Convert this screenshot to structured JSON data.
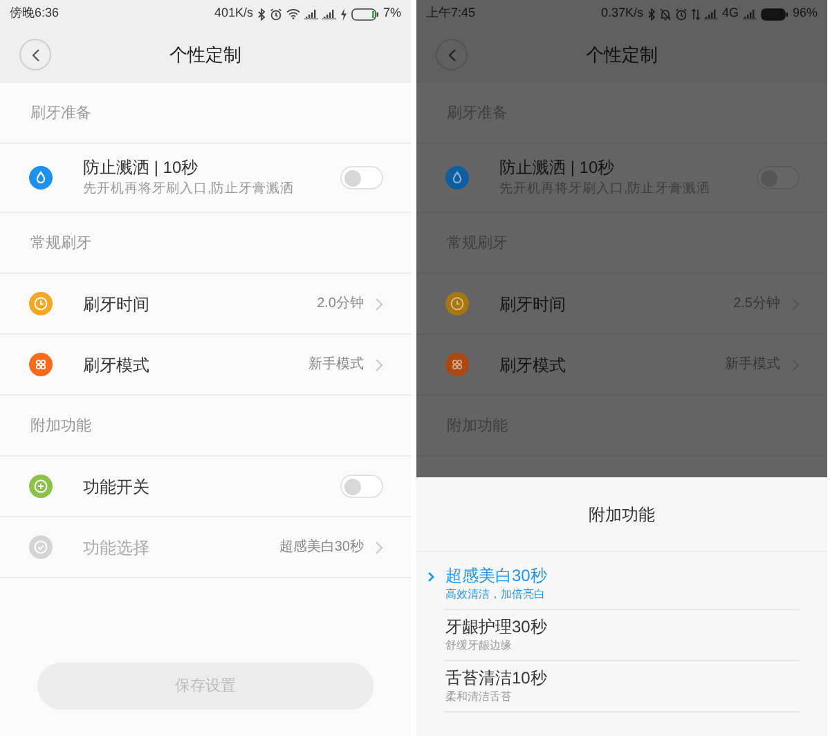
{
  "screens": [
    {
      "status_bar": {
        "time": "傍晚6:36",
        "speed": "401K/s",
        "indicators": [
          {
            "kind": "bluetooth"
          },
          {
            "kind": "alarm"
          },
          {
            "kind": "wifi"
          },
          {
            "kind": "signal"
          },
          {
            "kind": "signal"
          },
          {
            "kind": "charging"
          },
          {
            "kind": "battery_low"
          }
        ],
        "battery": "7%"
      },
      "header": {
        "title": "个性定制"
      },
      "sections": [
        {
          "title": "刷牙准备",
          "rows": [
            {
              "kind": "toggle",
              "color": "#1e90f0",
              "title": "防止溅洒 | 10秒",
              "subtitle": "先开机再将牙刷入口,防止牙膏溅洒",
              "on": false,
              "disabled": false
            }
          ]
        },
        {
          "title": "常规刷牙",
          "rows": [
            {
              "kind": "value",
              "color": "#f5a623",
              "title": "刷牙时间",
              "value": "2.0分钟",
              "disabled": false
            },
            {
              "kind": "value",
              "color": "#fa6a1e",
              "title": "刷牙模式",
              "value": "新手模式",
              "disabled": false
            }
          ]
        },
        {
          "title": "附加功能",
          "rows": [
            {
              "kind": "toggle",
              "color": "#8bc34a",
              "title": "功能开关",
              "on": false,
              "disabled": false
            },
            {
              "kind": "value",
              "color": "#d4d4d4",
              "title": "功能选择",
              "value": "超感美白30秒",
              "disabled": true
            }
          ]
        }
      ],
      "save_button": {
        "label": "保存设置",
        "disabled": true
      }
    },
    {
      "status_bar": {
        "time": "上午7:45",
        "speed": "0.37K/s",
        "indicators": [
          {
            "kind": "bluetooth"
          },
          {
            "kind": "mute"
          },
          {
            "kind": "alarm"
          },
          {
            "kind": "data"
          },
          {
            "kind": "signal"
          },
          {
            "kind": "text",
            "text": "4G"
          },
          {
            "kind": "signal"
          },
          {
            "kind": "battery_full"
          }
        ],
        "battery": "96%"
      },
      "header": {
        "title": "个性定制"
      },
      "sections": [
        {
          "title": "刷牙准备",
          "rows": [
            {
              "kind": "toggle",
              "color": "#0d5fa0",
              "title": "防止溅洒 | 10秒",
              "subtitle": "先开机再将牙刷入口,防止牙膏溅洒",
              "on": false,
              "disabled": false
            }
          ]
        },
        {
          "title": "常规刷牙",
          "rows": [
            {
              "kind": "value",
              "color": "#a8760f",
              "title": "刷牙时间",
              "value": "2.5分钟",
              "disabled": false
            },
            {
              "kind": "value",
              "color": "#aa4810",
              "title": "刷牙模式",
              "value": "新手模式",
              "disabled": false
            }
          ]
        },
        {
          "title": "附加功能"
        }
      ],
      "sheet": {
        "title": "附加功能",
        "options": [
          {
            "title": "超感美白30秒",
            "subtitle": "高效清洁，加倍亮白",
            "selected": true
          },
          {
            "title": "牙龈护理30秒",
            "subtitle": "舒缓牙龈边缘",
            "selected": false
          },
          {
            "title": "舌苔清洁10秒",
            "subtitle": "柔和清洁舌苔",
            "selected": false
          }
        ]
      }
    }
  ]
}
